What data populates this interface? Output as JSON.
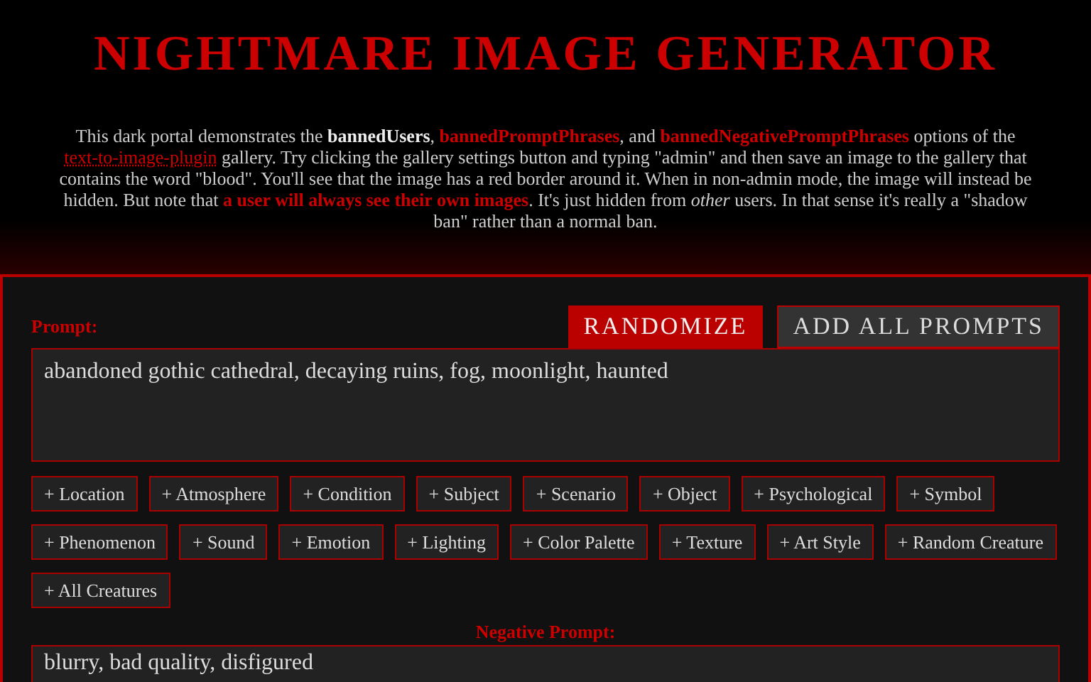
{
  "title": "NIGHTMARE IMAGE GENERATOR",
  "intro": [
    {
      "kind": "plain",
      "text": "This dark portal demonstrates the "
    },
    {
      "kind": "bold",
      "text": "bannedUsers"
    },
    {
      "kind": "plain",
      "text": ", "
    },
    {
      "kind": "accent",
      "text": "bannedPromptPhrases"
    },
    {
      "kind": "plain",
      "text": ", and "
    },
    {
      "kind": "accent",
      "text": "bannedNegativePromptPhrases"
    },
    {
      "kind": "plain",
      "text": " options of the "
    },
    {
      "kind": "link",
      "text": "text-to-image-plugin"
    },
    {
      "kind": "plain",
      "text": " gallery. Try clicking the gallery settings button and typing \"admin\" and then save an image to the gallery that contains the word \"blood\". You'll see that the image has a red border around it. When in non-admin mode, the image will instead be hidden. But note that "
    },
    {
      "kind": "accent",
      "text": "a user will always see their own images"
    },
    {
      "kind": "plain",
      "text": ". It's just hidden from "
    },
    {
      "kind": "italic",
      "text": "other"
    },
    {
      "kind": "plain",
      "text": " users. In that sense it's really a \"shadow ban\" rather than a normal ban."
    }
  ],
  "prompt": {
    "label": "Prompt:",
    "value": "abandoned gothic cathedral, decaying ruins, fog, moonlight, haunted"
  },
  "buttons": [
    {
      "label": "RANDOMIZE",
      "kind": "primary"
    },
    {
      "label": "ADD ALL PROMPTS",
      "kind": "secondary"
    }
  ],
  "chips": [
    "+ Location",
    "+ Atmosphere",
    "+ Condition",
    "+ Subject",
    "+ Scenario",
    "+ Object",
    "+ Psychological",
    "+ Symbol",
    "+ Phenomenon",
    "+ Sound",
    "+ Emotion",
    "+ Lighting",
    "+ Color Palette",
    "+ Texture",
    "+ Art Style",
    "+ Random Creature",
    "+ All Creatures"
  ],
  "negative_prompt": {
    "label": "Negative Prompt:",
    "value": "blurry, bad quality, disfigured"
  }
}
